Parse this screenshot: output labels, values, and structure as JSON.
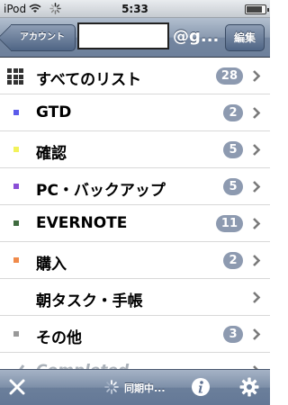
{
  "status_bar": {
    "carrier": "iPod",
    "time": "5:33",
    "battery_level": 0.85,
    "icons": [
      "wifi-icon",
      "activity-spinner-icon",
      "battery-icon"
    ]
  },
  "nav": {
    "back_label": "アカウント",
    "title_suffix": "@g...",
    "edit_label": "編集"
  },
  "lists": [
    {
      "label": "すべてのリスト",
      "count": "28",
      "icon": "grid-icon",
      "color": "#333333"
    },
    {
      "label": "GTD",
      "count": "2",
      "icon": "bullet",
      "color": "#5b5bea"
    },
    {
      "label": "確認",
      "count": "5",
      "icon": "bullet",
      "color": "#f2f25a"
    },
    {
      "label": "PC・バックアップ",
      "count": "5",
      "icon": "bullet",
      "color": "#8a4fd6"
    },
    {
      "label": "EVERNOTE",
      "count": "11",
      "icon": "bullet",
      "color": "#3f6b3f"
    },
    {
      "label": "購入",
      "count": "2",
      "icon": "bullet",
      "color": "#f08a4a"
    },
    {
      "label": "朝タスク・手帳",
      "count": "",
      "icon": "none",
      "color": ""
    },
    {
      "label": "その他",
      "count": "3",
      "icon": "bullet",
      "color": "#999999"
    },
    {
      "label": "Completed",
      "count": "",
      "icon": "check-icon",
      "color": "#aab1b9"
    }
  ],
  "toolbar": {
    "sync_label": "同期中...",
    "icons": [
      "close-icon",
      "sync-spinner-icon",
      "info-icon",
      "gear-icon"
    ]
  },
  "colors": {
    "nav_bar": "#7486a0",
    "badge": "#8d9ab0"
  }
}
